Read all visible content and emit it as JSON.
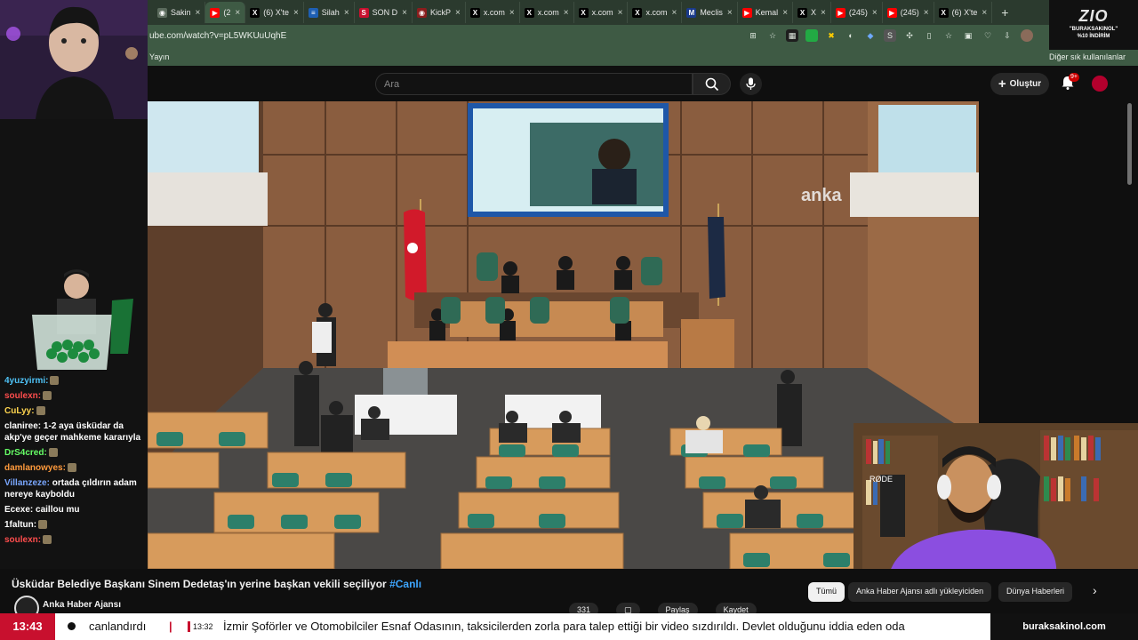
{
  "browser": {
    "tabs": [
      {
        "label": "Sakin",
        "fav_color": "#5b6b5d",
        "fav": "◉"
      },
      {
        "label": "(2",
        "fav_color": "#ff0000",
        "fav": "▶",
        "active": true
      },
      {
        "label": "(6) X'te",
        "fav_color": "#000000",
        "fav": "X"
      },
      {
        "label": "Silah",
        "fav_color": "#1e5fb3",
        "fav": "≡"
      },
      {
        "label": "SON D",
        "fav_color": "#c8102e",
        "fav": "S"
      },
      {
        "label": "KickP",
        "fav_color": "#8b1d1d",
        "fav": "◉"
      },
      {
        "label": "x.com",
        "fav_color": "#000000",
        "fav": "X"
      },
      {
        "label": "x.com",
        "fav_color": "#000000",
        "fav": "X"
      },
      {
        "label": "x.com",
        "fav_color": "#000000",
        "fav": "X"
      },
      {
        "label": "x.com",
        "fav_color": "#000000",
        "fav": "X"
      },
      {
        "label": "Meclis",
        "fav_color": "#1a3a8a",
        "fav": "M"
      },
      {
        "label": "Kemal",
        "fav_color": "#ff0000",
        "fav": "▶"
      },
      {
        "label": "X",
        "fav_color": "#000000",
        "fav": "X"
      },
      {
        "label": "(245)",
        "fav_color": "#ff0000",
        "fav": "▶"
      },
      {
        "label": "(245)",
        "fav_color": "#ff0000",
        "fav": "▶"
      },
      {
        "label": "(6) X'te",
        "fav_color": "#000000",
        "fav": "X"
      }
    ],
    "new_tab": "+",
    "url": "ube.com/watch?v=pL5WKUuUqhE",
    "bookmark_left": "Yayın",
    "bookmark_right": "Diğer sık kullanılanlar"
  },
  "youtube": {
    "search_placeholder": "Ara",
    "create_label": "Oluştur",
    "notif_count": "9+",
    "video_title": "Üsküdar Belediye Başkanı Sinem Dedetaş'ın yerine başkan vekili seçiliyor",
    "video_hashtag": "#Canlı",
    "channel_name": "Anka Haber Ajansı",
    "chips": [
      "Tümü",
      "Anka Haber Ajansı adlı yükleyiciden",
      "Dünya Haberleri"
    ],
    "actions": [
      "331",
      "Paylaş",
      "Kaydet"
    ],
    "watermark": "anka"
  },
  "overlay": {
    "sponsor_brand": "ZIO",
    "sponsor_line1": "\"BURAKSAKINOL\"",
    "sponsor_line2": "%10 İNDİRİM",
    "chat": [
      {
        "user": "4yuzyirmi:",
        "color": "#4fc3f7",
        "msg": ""
      },
      {
        "user": "soulexn:",
        "color": "#ff4d4d",
        "msg": ""
      },
      {
        "user": "CuLyy:",
        "color": "#ffd54f",
        "msg": ""
      },
      {
        "user": "claniree:",
        "color": "#ffffff",
        "msg": "1-2 aya üsküdar da akp'ye geçer mahkeme kararıyla"
      },
      {
        "user": "DrS4cred:",
        "color": "#66ff66",
        "msg": ""
      },
      {
        "user": "damlanowyes:",
        "color": "#ff9a3c",
        "msg": ""
      },
      {
        "user": "Villanzeze:",
        "color": "#7aa7ff",
        "msg": "ortada çıldırın adam nereye kayboldu"
      },
      {
        "user": "Ecexe:",
        "color": "#ffffff",
        "msg": "caillou mu"
      },
      {
        "user": "1faltun:",
        "color": "#ffffff",
        "msg": ""
      },
      {
        "user": "soulexn:",
        "color": "#ff4d4d",
        "msg": ""
      }
    ]
  },
  "ticker": {
    "time": "13:43",
    "text1": "canlandırdı",
    "sep": "|",
    "time2": "13:32",
    "text2": "İzmir Şoförler ve Otomobilciler Esnaf Odasının, taksicilerden zorla para talep ettiği bir video sızdırıldı. Devlet olduğunu iddia eden oda",
    "brand": "buraksakinol.com"
  }
}
